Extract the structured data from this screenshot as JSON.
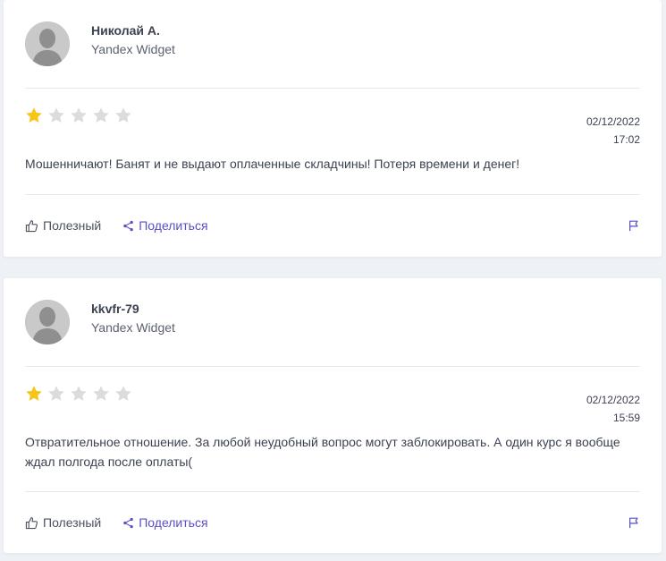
{
  "reviews": [
    {
      "author": "Николай А.",
      "source": "Yandex Widget",
      "rating": 1,
      "max_rating": 5,
      "date": "02/12/2022",
      "time": "17:02",
      "text": "Мошенничают! Банят и не выдают оплаченные складчины! Потеря времени и денег!",
      "helpful_label": "Полезный",
      "share_label": "Поделиться"
    },
    {
      "author": "kkvfr-79",
      "source": "Yandex Widget",
      "rating": 1,
      "max_rating": 5,
      "date": "02/12/2022",
      "time": "15:59",
      "text": "Отвратительное отношение. За любой неудобный вопрос могут заблокировать. А один курс я вообще ждал полгода после оплаты(",
      "helpful_label": "Полезный",
      "share_label": "Поделиться"
    }
  ],
  "icons": {
    "avatar": "user-silhouette-icon",
    "star": "star-icon",
    "helpful": "thumbs-up-icon",
    "share": "share-icon",
    "report": "flag-icon"
  },
  "colors": {
    "star_filled": "#f5c518",
    "star_empty": "#d9d9d9",
    "accent": "#5a4fc6",
    "background": "#eef1f5",
    "card": "#ffffff"
  }
}
